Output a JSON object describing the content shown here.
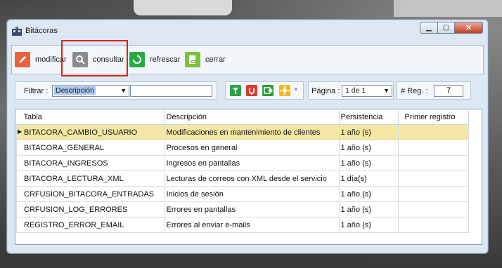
{
  "window": {
    "title": "Bitácoras"
  },
  "toolbar": {
    "modificar": "modificar",
    "consultar": "consultar",
    "refrescar": "refrescar",
    "cerrar": "cerrar"
  },
  "filter": {
    "label": "Filtrar :",
    "field_value": "Descripción",
    "text_value": "",
    "page_label": "Página :",
    "page_value": "1 de 1",
    "reg_label": "# Reg. :",
    "reg_value": "7"
  },
  "grid": {
    "columns": [
      "Tabla",
      "Descripción",
      "Persistencia",
      "Primer registro"
    ],
    "rows": [
      {
        "tabla": "BITACORA_CAMBIO_USUARIO",
        "descripcion": "Modificaciones en mantenimiento de clientes",
        "persistencia": "1 año (s)",
        "primer": ""
      },
      {
        "tabla": "BITACORA_GENERAL",
        "descripcion": "Procesos en general",
        "persistencia": "1 año (s)",
        "primer": ""
      },
      {
        "tabla": "BITACORA_INGRESOS",
        "descripcion": "Ingresos en pantallas",
        "persistencia": "1 año (s)",
        "primer": ""
      },
      {
        "tabla": "BITACORA_LECTURA_XML",
        "descripcion": "Lecturas de correos con XML desde el servicio",
        "persistencia": "1 día(s)",
        "primer": ""
      },
      {
        "tabla": "CRFUSION_BITACORA_ENTRADAS",
        "descripcion": "Inicios de sesión",
        "persistencia": "1 año (s)",
        "primer": ""
      },
      {
        "tabla": "CRFUSION_LOG_ERRORES",
        "descripcion": "Errores en pantallas",
        "persistencia": "1 año (s)",
        "primer": ""
      },
      {
        "tabla": "REGISTRO_ERROR_EMAIL",
        "descripcion": "Errores al enviar e-mails",
        "persistencia": "1 año (s)",
        "primer": ""
      }
    ]
  },
  "colors": {
    "selected_row": "#f5e7a3",
    "highlight": "#e0201a"
  }
}
